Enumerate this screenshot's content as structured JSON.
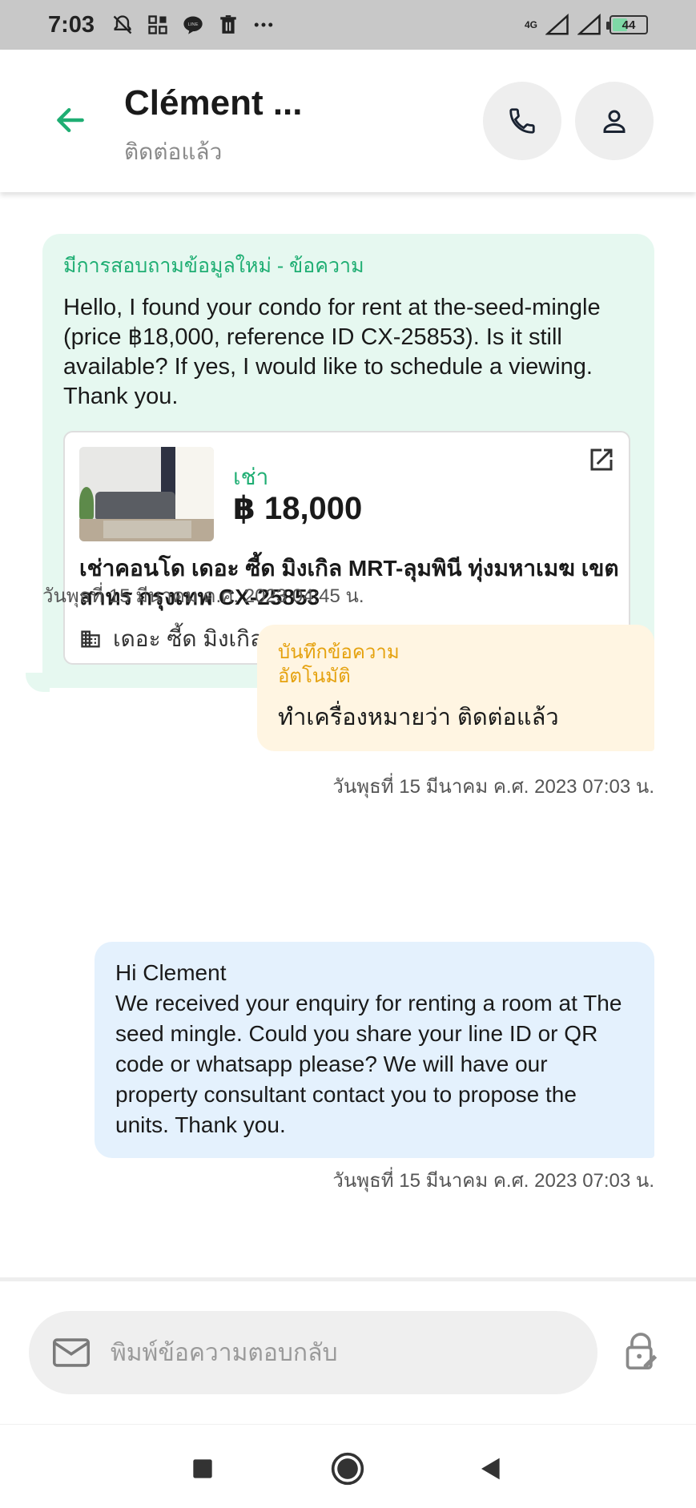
{
  "status_bar": {
    "time": "7:03",
    "network_label": "4G",
    "battery": "44",
    "icons": [
      "bell-off-icon",
      "grid-icon",
      "line-app-icon",
      "trash-icon",
      "more-icon",
      "signal-icon",
      "signal-icon",
      "battery-icon"
    ]
  },
  "header": {
    "title": "Clément ...",
    "subtitle": "ติดต่อแล้ว"
  },
  "messages": {
    "inquiry": {
      "label": "มีการสอบถามข้อมูลใหม่ - ข้อความ",
      "text": "Hello, I found your condo for rent at the-seed-mingle (price ฿18,000, reference ID CX-25853). Is it still available? If yes, I would like to schedule a viewing. Thank you.",
      "listing": {
        "type": "เช่า",
        "price": "฿ 18,000",
        "title": "เช่าคอนโด  เดอะ ซี้ด มิงเกิล MRT-ลุมพินี ทุ่งมหาเมฆ เขต สาทร กรุงเทพ CX-25853",
        "building": "เดอะ ซี้ด มิงเกิล"
      },
      "time": "วันพุธที่ 15 มีนาคม ค.ศ. 2023 04:45 น."
    },
    "auto_note": {
      "label": "บันทึกข้อความอัตโนมัติ",
      "text": "ทำเครื่องหมายว่า ติดต่อแล้ว",
      "time": "วันพุธที่ 15 มีนาคม ค.ศ. 2023 07:03 น."
    },
    "reply": {
      "text": "Hi Clement\nWe received your enquiry for renting a room at The seed mingle. Could you share your line ID or QR code or whatsapp please? We will have our property consultant contact you to propose the units. Thank you.",
      "time": "วันพุธที่ 15 มีนาคม ค.ศ. 2023 07:03 น."
    }
  },
  "composer": {
    "placeholder": "พิมพ์ข้อความตอบกลับ"
  },
  "colors": {
    "accent_green": "#1fae73",
    "incoming_bubble": "#e6f8f0",
    "note_bubble": "#fff5e2",
    "note_label": "#e5a20f",
    "outgoing_bubble": "#e4f1fd"
  }
}
